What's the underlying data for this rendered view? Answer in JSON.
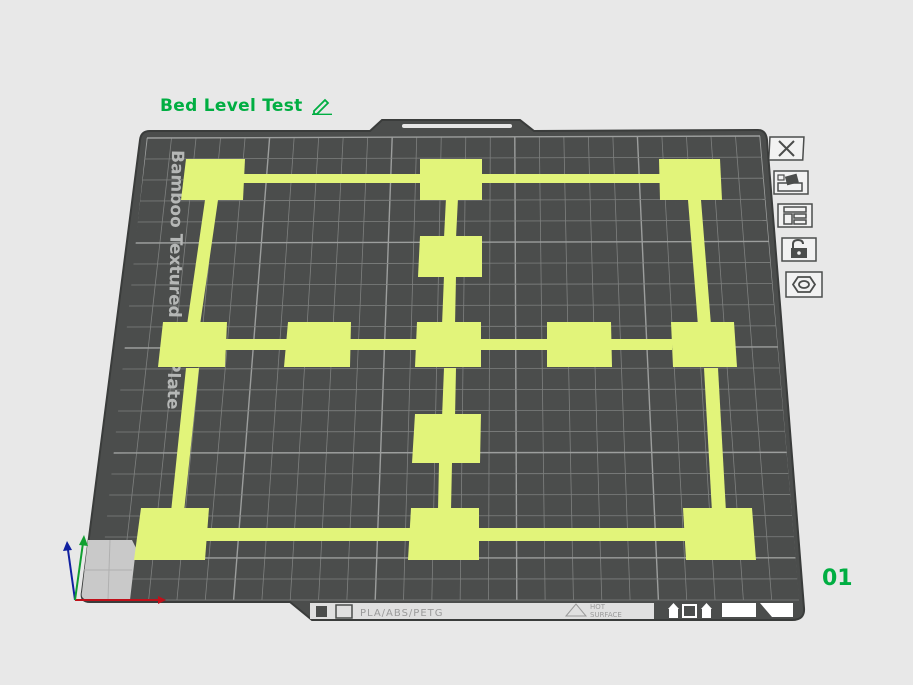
{
  "plate": {
    "title": "Bed Level Test",
    "number": "01",
    "plate_type_label": "Bamboo Textured PEI Plate",
    "filament_label": "PLA/ABS/PETG",
    "surface_label_line1": "HOT",
    "surface_label_line2": "SURFACE"
  },
  "toolbar": {
    "items": [
      {
        "name": "close-plate",
        "icon": "close-icon"
      },
      {
        "name": "auto-orient",
        "icon": "orient-icon"
      },
      {
        "name": "arrange",
        "icon": "arrange-icon"
      },
      {
        "name": "lock",
        "icon": "lock-icon"
      },
      {
        "name": "plate-settings",
        "icon": "hexagon-settings-icon"
      }
    ]
  },
  "colors": {
    "accent": "#00ae42",
    "bed": "#4b4d4c",
    "bed_edge": "#3a3c3b",
    "grid": "#8a8c8b",
    "model": "#e2f47a",
    "background": "#e8e8e8"
  }
}
